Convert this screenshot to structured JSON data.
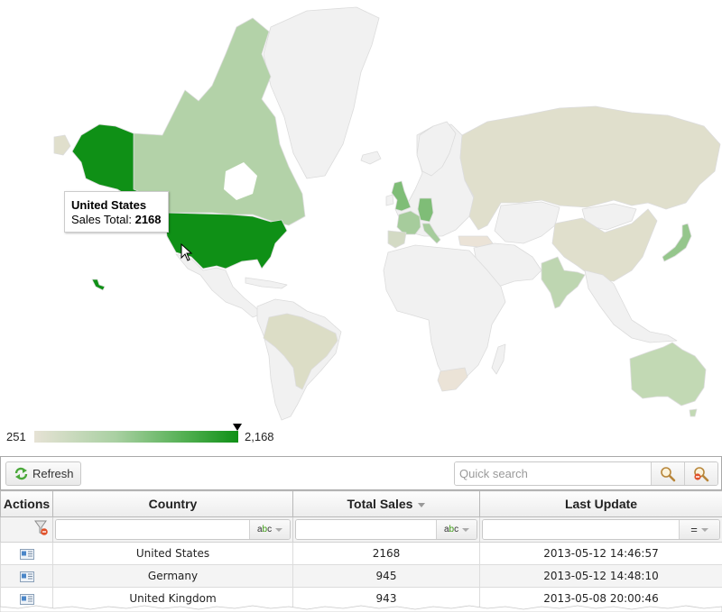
{
  "map": {
    "colors": {
      "no_data": "#f1f1f1",
      "min": "#e6e2d5",
      "max": "#0f9016",
      "border": "#dcdcdc"
    },
    "countries": [
      {
        "name": "United States",
        "sales": 2168,
        "color": "#0f9016"
      },
      {
        "name": "Canada",
        "sales": null,
        "color": "#b3d2a8"
      },
      {
        "name": "Germany",
        "sales": 945,
        "color": "#7fbd77"
      },
      {
        "name": "United Kingdom",
        "sales": 943,
        "color": "#7fbd77"
      },
      {
        "name": "France",
        "sales": null,
        "color": "#a6cc9c"
      },
      {
        "name": "Italy",
        "sales": null,
        "color": "#a6cc9c"
      },
      {
        "name": "Spain",
        "sales": null,
        "color": "#d3dac4"
      },
      {
        "name": "Japan",
        "sales": null,
        "color": "#95c68c"
      },
      {
        "name": "India",
        "sales": null,
        "color": "#bed6b1"
      },
      {
        "name": "Australia",
        "sales": null,
        "color": "#c2d9b4"
      },
      {
        "name": "Russia",
        "sales": null,
        "color": "#e0dfcc"
      },
      {
        "name": "China",
        "sales": null,
        "color": "#e0dfcc"
      },
      {
        "name": "Brazil",
        "sales": null,
        "color": "#dcddc6"
      },
      {
        "name": "Turkey",
        "sales": null,
        "color": "#ebe3d7"
      },
      {
        "name": "South Africa",
        "sales": null,
        "color": "#ebe3d7"
      }
    ],
    "tooltip": {
      "country": "United States",
      "label": "Sales Total: ",
      "value": "2168"
    },
    "legend": {
      "min_label": "251",
      "max_label": "2,168",
      "marker_value": 2168
    }
  },
  "toolbar": {
    "refresh_label": "Refresh",
    "search_placeholder": "Quick search",
    "search_value": ""
  },
  "grid": {
    "columns": [
      {
        "label": "Actions"
      },
      {
        "label": "Country"
      },
      {
        "label": "Total Sales",
        "sorted": "desc"
      },
      {
        "label": "Last Update"
      }
    ],
    "filters": [
      {
        "op": "abc"
      },
      {
        "op": "abc"
      },
      {
        "op": "="
      }
    ],
    "rows": [
      {
        "country": "United States",
        "total_sales": "2168",
        "last_update": "2013-05-12 14:46:57"
      },
      {
        "country": "Germany",
        "total_sales": "945",
        "last_update": "2013-05-12 14:48:10"
      },
      {
        "country": "United Kingdom",
        "total_sales": "943",
        "last_update": "2013-05-08 20:00:46"
      }
    ]
  }
}
